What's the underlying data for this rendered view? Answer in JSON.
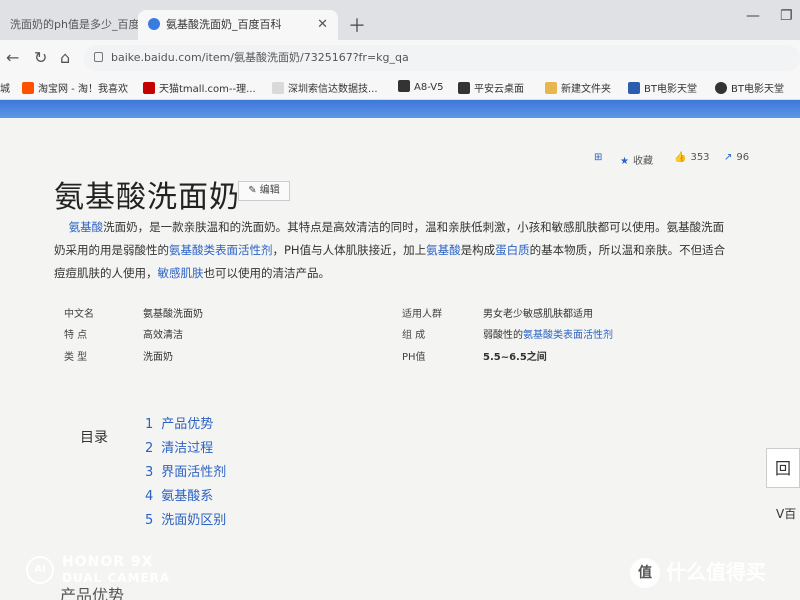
{
  "browser": {
    "tabs": [
      {
        "label": "洗面奶的ph值是多少_百度搜",
        "active": false
      },
      {
        "label": "氨基酸洗面奶_百度百科",
        "active": true
      }
    ],
    "new_tab_icon": "plus-icon",
    "url": "baike.baidu.com/item/氨基酸洗面奶/7325167?fr=kg_qa",
    "bookmarks": [
      {
        "label": "城",
        "icon": "folder-icon",
        "color": "#e8b64c"
      },
      {
        "label": "淘宝网 - 淘！我喜欢",
        "icon": "taobao-icon",
        "color": "#ff5000"
      },
      {
        "label": "天猫tmall.com--理...",
        "icon": "tmall-icon",
        "color": "#c40000"
      },
      {
        "label": "深圳索信达数据技...",
        "icon": "page-icon",
        "color": "#d9d9d9"
      },
      {
        "label": "A8-V5",
        "icon": "seeyon-icon",
        "color": "#333333"
      },
      {
        "label": "平安云桌面",
        "icon": "pingan-icon",
        "color": "#333333"
      },
      {
        "label": "新建文件夹",
        "icon": "folder-icon",
        "color": "#e8b64c"
      },
      {
        "label": "BT电影天堂",
        "icon": "bt-icon",
        "color": "#2a5db0"
      },
      {
        "label": "BT电影天堂",
        "icon": "globe-icon",
        "color": "#333333"
      }
    ]
  },
  "article": {
    "actions": {
      "add_label": "",
      "favorite_label": "收藏",
      "like_count": "353",
      "share_count": "96"
    },
    "title": "氨基酸洗面奶",
    "edit_label": "编辑",
    "intro": {
      "p1_link": "氨基酸",
      "p1_text": "洗面奶，是一款亲肤温和的洗面奶。其特点是高效清洁的同时，温和亲肤低刺激，小孩和敏感肌肤都可以使用。氨基酸洗面奶采用的用是弱酸性的",
      "p2_link": "氨基酸类表面活性剂",
      "p2_text": "，PH值与人体肌肤接近，加上",
      "p3_link": "氨基酸",
      "p3_text": "是构成",
      "p4_link": "蛋白质",
      "p4_text": "的基本物质，所以温和亲肤。不但适合痘痘肌肤的人使用，",
      "p5_link": "敏感肌肤",
      "p5_text": "也可以使用的清洁产品。"
    },
    "info_left": [
      {
        "label": "中文名",
        "value": "氨基酸洗面奶"
      },
      {
        "label": "特    点",
        "value": "高效清洁"
      },
      {
        "label": "类    型",
        "value": "洗面奶"
      }
    ],
    "info_right": [
      {
        "label": "适用人群",
        "value": "男女老少敏感肌肤都适用"
      },
      {
        "label": "组    成",
        "value_prefix": "弱酸性的",
        "value_link": "氨基酸类表面活性剂"
      },
      {
        "label": "PH值",
        "value": "5.5~6.5之间"
      }
    ],
    "toc_title": "目录",
    "toc": [
      {
        "num": "1",
        "label": "产品优势"
      },
      {
        "num": "2",
        "label": "清洁过程"
      },
      {
        "num": "3",
        "label": "界面活性剂"
      },
      {
        "num": "4",
        "label": "氨基酸系"
      },
      {
        "num": "5",
        "label": "洗面奶区别"
      }
    ],
    "side_box_label": "回",
    "side_text": "V百",
    "bottom_heading": "产品优势"
  },
  "watermarks": {
    "camera_logo": "AI",
    "camera_line1": "HONOR 9X",
    "camera_line2": "DUAL CAMERA",
    "site_badge": "值",
    "site_name": "什么值得买"
  }
}
